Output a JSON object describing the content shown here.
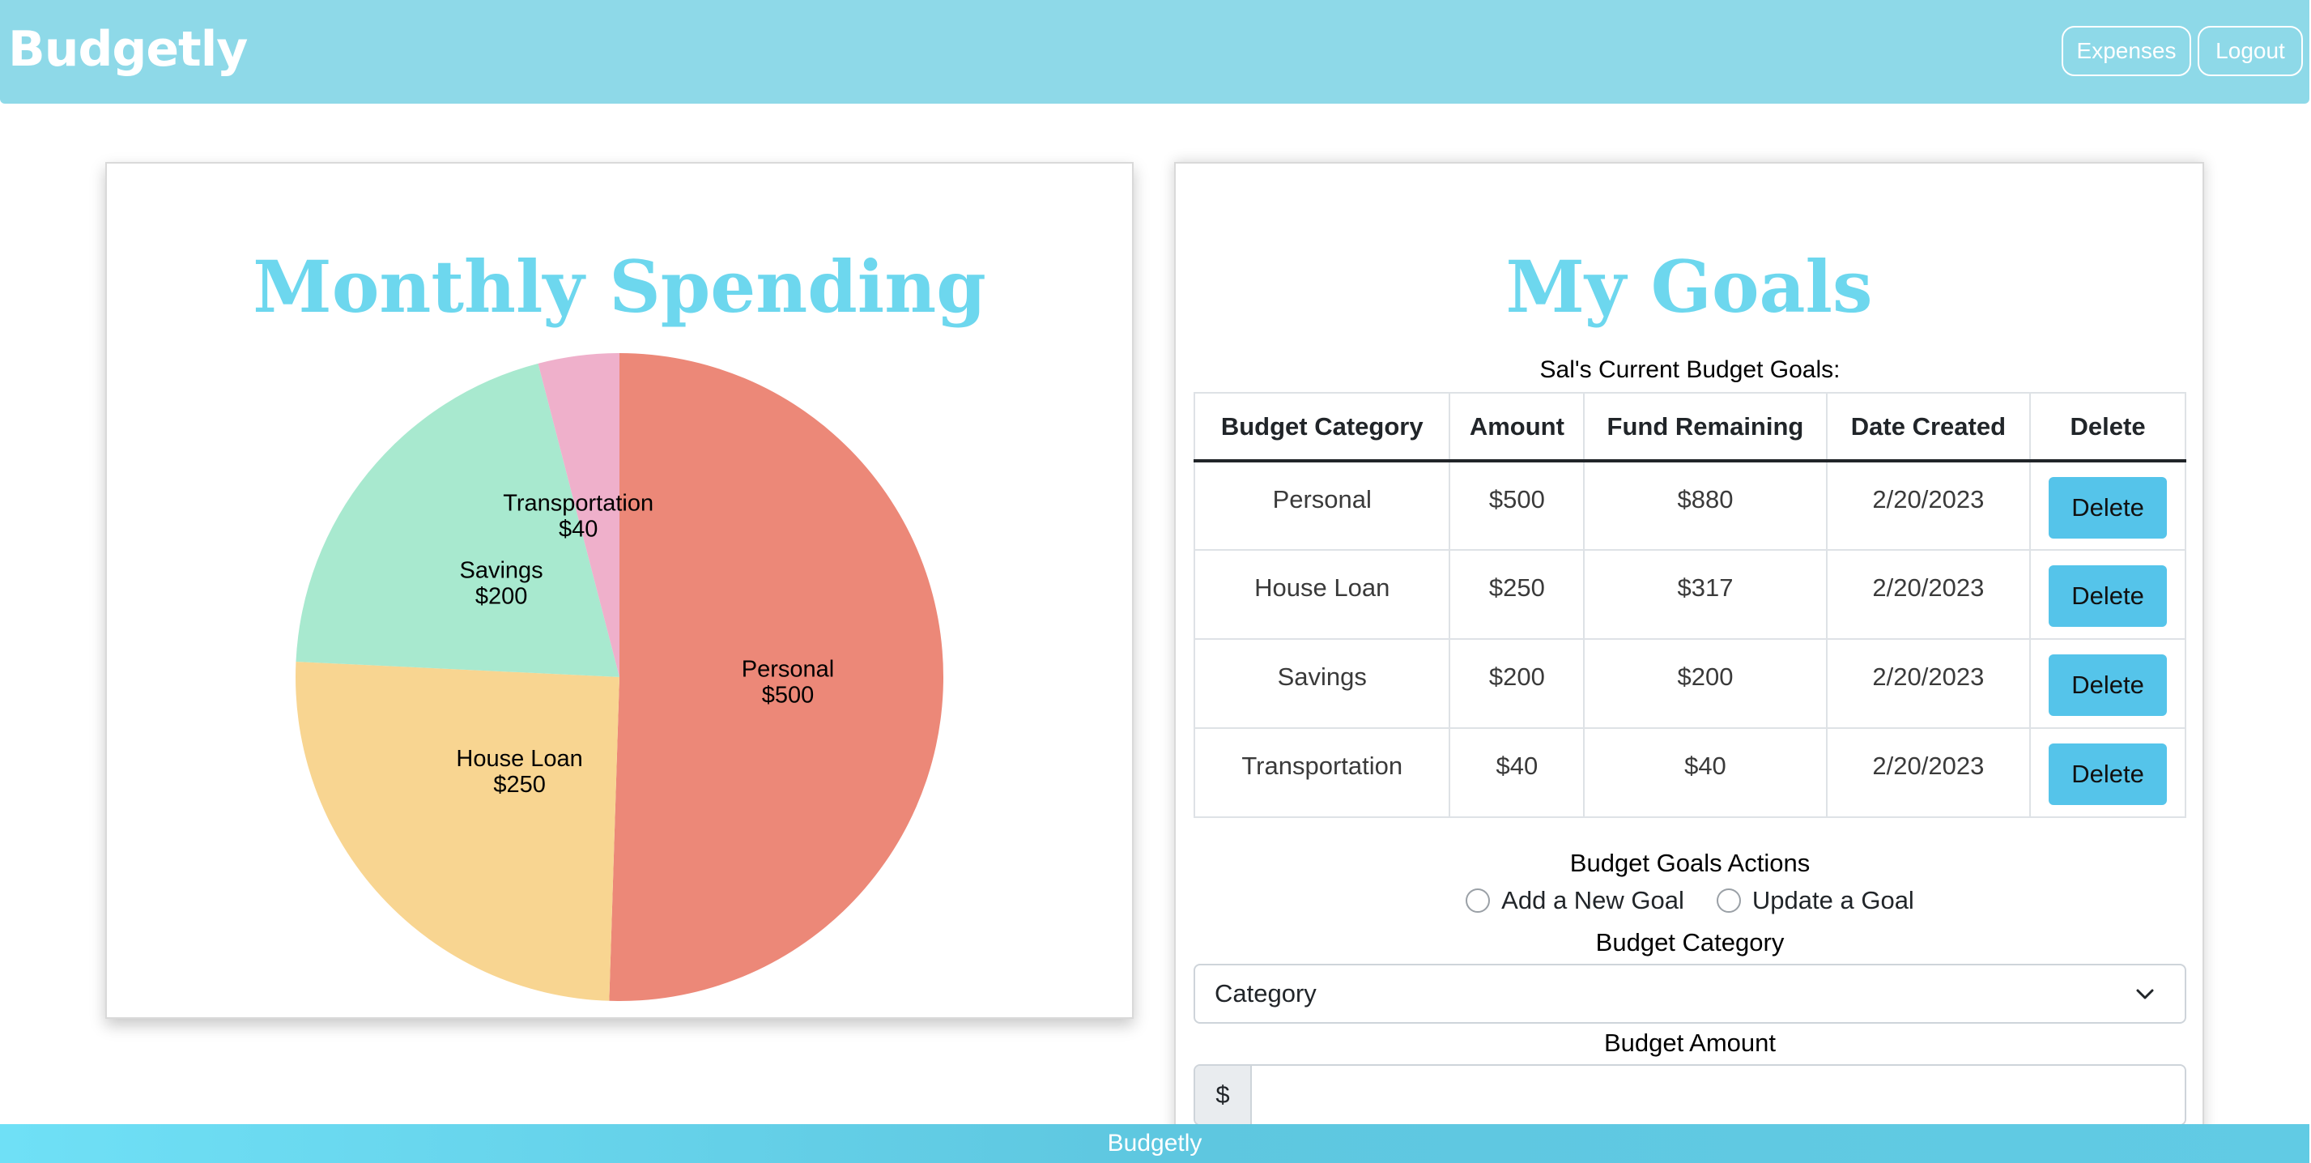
{
  "navbar": {
    "brand": "Budgetly",
    "expenses_label": "Expenses",
    "logout_label": "Logout",
    "color": "#8ed9e8"
  },
  "spending": {
    "title": "Monthly Spending"
  },
  "chart_data": {
    "type": "pie",
    "title": "Monthly Spending",
    "slices": [
      {
        "label": "Personal",
        "value": 500,
        "value_label": "$500",
        "color": "#ec8878"
      },
      {
        "label": "House Loan",
        "value": 250,
        "value_label": "$250",
        "color": "#f8d591"
      },
      {
        "label": "Savings",
        "value": 200,
        "value_label": "$200",
        "color": "#a8e9cf"
      },
      {
        "label": "Transportation",
        "value": 40,
        "value_label": "$40",
        "color": "#efb0cb"
      }
    ]
  },
  "goals": {
    "title": "My Goals",
    "caption": "Sal's Current Budget Goals:",
    "headers": [
      "Budget Category",
      "Amount",
      "Fund Remaining",
      "Date Created",
      "Delete"
    ],
    "rows": [
      {
        "category": "Personal",
        "amount": "$500",
        "remaining": "$880",
        "date": "2/20/2023",
        "delete": "Delete"
      },
      {
        "category": "House Loan",
        "amount": "$250",
        "remaining": "$317",
        "date": "2/20/2023",
        "delete": "Delete"
      },
      {
        "category": "Savings",
        "amount": "$200",
        "remaining": "$200",
        "date": "2/20/2023",
        "delete": "Delete"
      },
      {
        "category": "Transportation",
        "amount": "$40",
        "remaining": "$40",
        "date": "2/20/2023",
        "delete": "Delete"
      }
    ],
    "delete_button_color": "#55c4ea"
  },
  "actions": {
    "title": "Budget Goals Actions",
    "options": [
      "Add a New Goal",
      "Update a Goal"
    ],
    "category_label": "Budget Category",
    "category_selected": "Category",
    "amount_label": "Budget Amount",
    "amount_prefix": "$",
    "amount_value": ""
  },
  "footer": {
    "text": "Budgetly"
  }
}
